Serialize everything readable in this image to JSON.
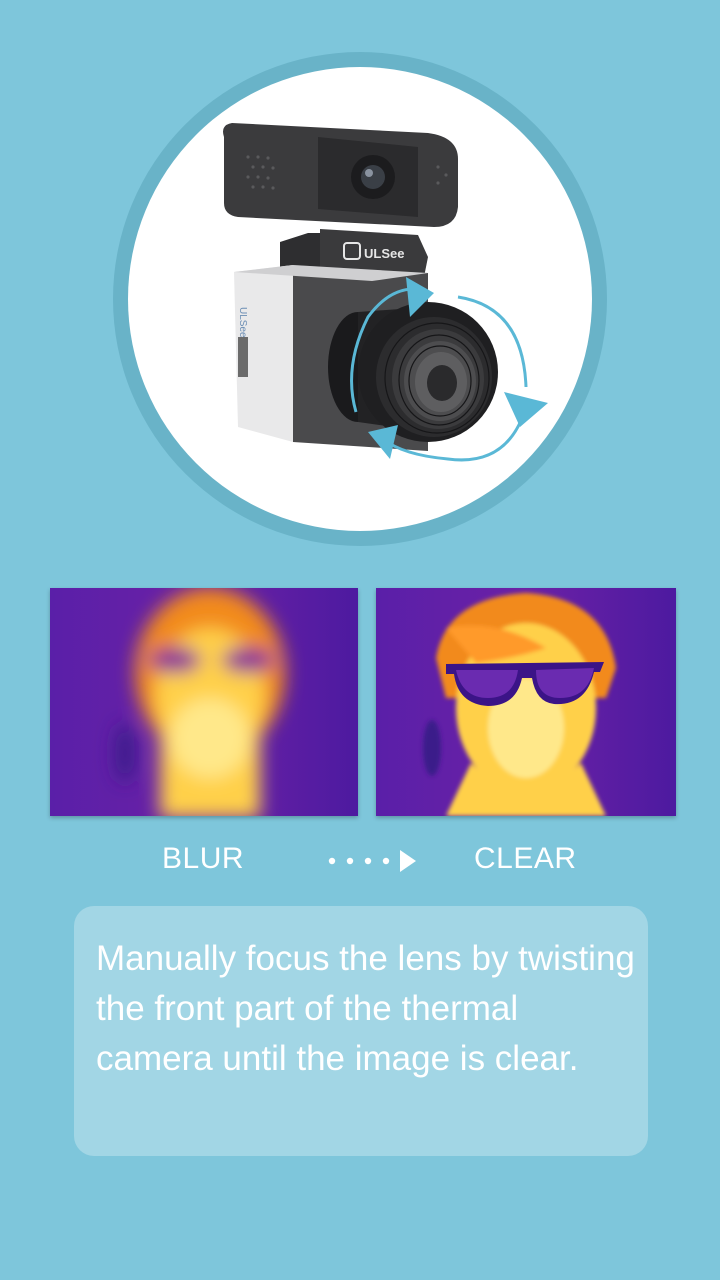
{
  "hero": {
    "brand_label": "ULSee",
    "side_brand_label": "ULSee"
  },
  "comparison": {
    "before_label": "BLUR",
    "after_label": "CLEAR"
  },
  "instruction": {
    "text": "Manually focus the lens by twisting the front part of the thermal camera until the image is clear."
  },
  "colors": {
    "background": "#7ec6db",
    "ring": "#69b3c8",
    "arrow": "#5ab8d6",
    "thermal_cold": "#5a1fa8",
    "thermal_warm": "#f28a1d",
    "thermal_hot": "#ffe88a"
  }
}
